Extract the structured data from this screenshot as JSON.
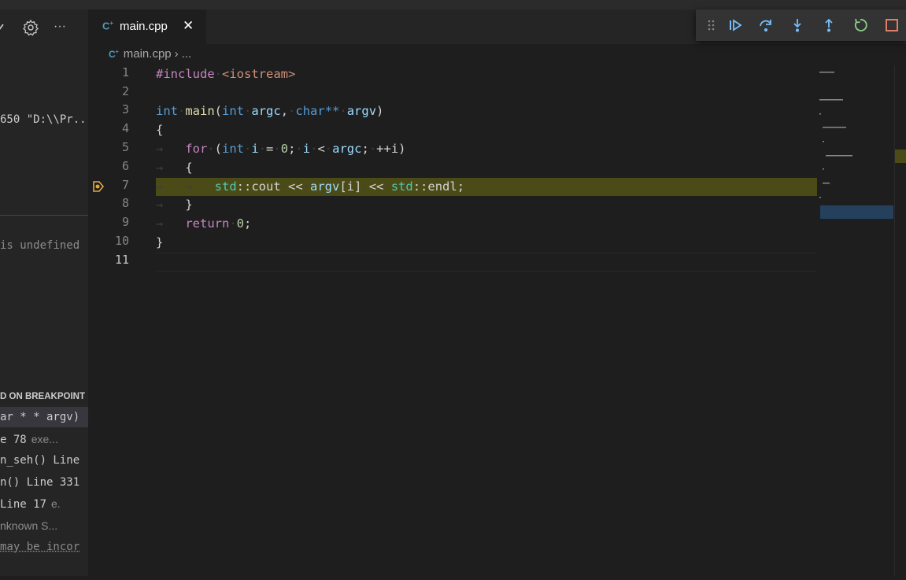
{
  "tab": {
    "label": "main.cpp",
    "close": "✕"
  },
  "breadcrumb": {
    "file": "main.cpp",
    "rest": "..."
  },
  "sidebar": {
    "overflow_label": "···",
    "launch_text": "650 \"D:\\\\Pr...",
    "watch_text": "is undefined",
    "callstack_header": "D ON BREAKPOINT",
    "frames": [
      {
        "fn": "ar * * argv)",
        "extra": ""
      },
      {
        "fn": "e 78",
        "extra": "exe..."
      },
      {
        "fn": "n_seh() Line",
        "extra": ""
      },
      {
        "fn": "n() Line 331",
        "extra": ""
      },
      {
        "fn": "Line 17",
        "extra": "e."
      },
      {
        "fn": "nknown S...",
        "extra": ""
      },
      {
        "fn": " may be incor",
        "extra": ""
      }
    ]
  },
  "editor": {
    "line_numbers": [
      "1",
      "2",
      "3",
      "4",
      "5",
      "6",
      "7",
      "8",
      "9",
      "10",
      "11"
    ],
    "current_line": 7,
    "code": {
      "l1_directive": "#include",
      "l1_header": "<iostream>",
      "l3_int": "int",
      "l3_main": "main",
      "l3_paren": "(",
      "l3_int2": "int",
      "l3_argc": "argc",
      "l3_comma": ",",
      "l3_char": "char**",
      "l3_argv": "argv",
      "l3_close": ")",
      "l4": "{",
      "l5_for": "for",
      "l5_open": "(",
      "l5_int": "int",
      "l5_i": "i",
      "l5_eq": "=",
      "l5_zero": "0",
      "l5_semi": ";",
      "l5_i2": "i",
      "l5_lt": "<",
      "l5_argc": "argc",
      "l5_semi2": ";",
      "l5_inc": "++i)",
      "l6": "{",
      "l7_std": "std",
      "l7_scope": "::",
      "l7_cout": "cout",
      "l7_op1": "<<",
      "l7_argv": "argv",
      "l7_idx": "[i]",
      "l7_op2": "<<",
      "l7_std2": "std",
      "l7_scope2": "::",
      "l7_endl": "endl;",
      "l8": "}",
      "l9_return": "return",
      "l9_zero": "0",
      "l9_semi": ";",
      "l10": "}"
    }
  },
  "colors": {
    "breakpoint_current": "#e5a93b",
    "highlight": "#4b4b18",
    "debug_icons": "#75beff",
    "stop": "#f48771"
  },
  "icons": {
    "settings": "gear-icon",
    "more": "ellipsis-icon",
    "continue": "continue-icon",
    "step_over": "step-over-icon",
    "step_into": "step-into-icon",
    "step_out": "step-out-icon",
    "restart": "restart-icon",
    "stop": "stop-icon"
  }
}
